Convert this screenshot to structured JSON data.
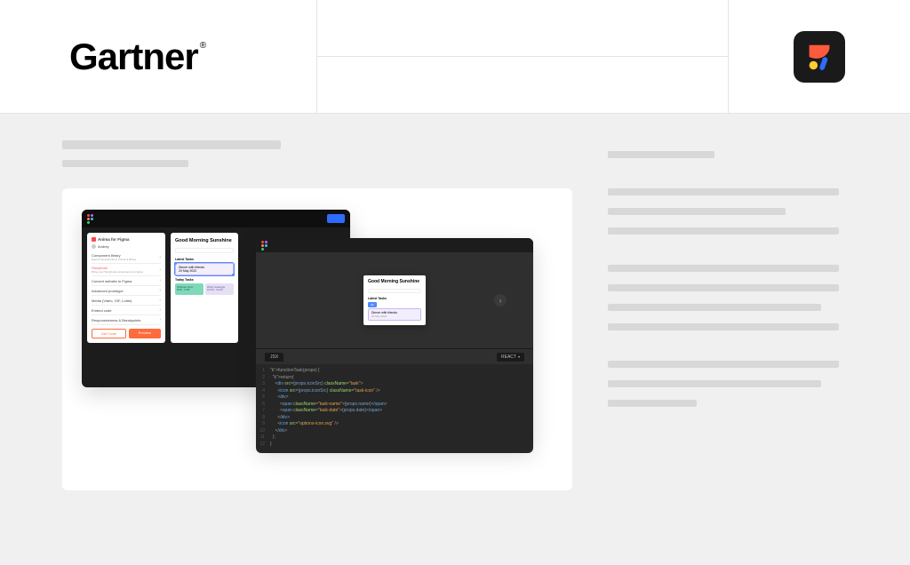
{
  "header": {
    "brand": "Gartner"
  },
  "left_placeholders": {
    "line1_w": 246,
    "line2_w": 142
  },
  "figma_window": {
    "plugin_title": "Anima for Figma",
    "user": "Andrey",
    "menu": [
      {
        "label": "Component library",
        "sub": "Export components to Anima & library"
      },
      {
        "label": "Storybook",
        "sub": "Bring your Storybook components to Figma",
        "accent": true
      },
      {
        "label": "Convert website to Figma"
      },
      {
        "label": "Advanced prototype"
      },
      {
        "label": "Media (Video, GIF, Lottie)"
      },
      {
        "label": "Embed code"
      },
      {
        "label": "Responsiveness & Breakpoints"
      }
    ],
    "buttons": {
      "outline": "Get Code",
      "fill": "Preview"
    },
    "mock": {
      "heading": "Good Morning Sunshine",
      "search_placeholder": "Search Personal task",
      "section1": "Latest Tasks",
      "task1": "Dinner with friends",
      "task1_date": "20 May 2022",
      "section2": "Today Tasks",
      "pill_a_title": "Workout Gym",
      "pill_a_sub": "8:00 - 9:00",
      "pill_b_title": "Work meetings",
      "pill_b_sub": "10:00 - 11:00"
    }
  },
  "code_window": {
    "mini": {
      "heading": "Good Morning Sunshine",
      "search_placeholder": "Search Personal task",
      "section": "Latest Tasks",
      "chip": "div",
      "task": "Dinner with friends",
      "task_date": "20 May 2022"
    },
    "tab": "JSX",
    "framework": "REACT",
    "code_lines": [
      "function Task(props) {",
      "  return (",
      "    <div src={props.iconSrc} className=\"task\">",
      "      <icon src={props.iconSrc} className=\"task-icon\" />",
      "      <div>",
      "        <span className=\"task-name\">{props.name}</span>",
      "        <span className=\"task-date\">{props.date}</span>",
      "      </div>",
      "      <icon src=\"options-icon.svg\" />",
      "    </div>",
      "  );",
      "}"
    ]
  },
  "right_placeholders": [
    120,
    260,
    200,
    260,
    260,
    260,
    240,
    260,
    260,
    240,
    100
  ]
}
